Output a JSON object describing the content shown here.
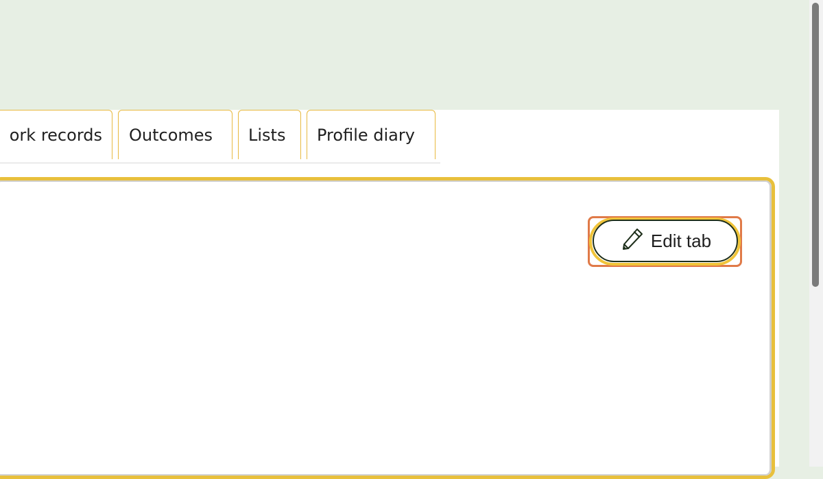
{
  "tabs": [
    {
      "label": "ork records",
      "active": false
    },
    {
      "label": "Outcomes",
      "active": false
    },
    {
      "label": "Lists",
      "active": true
    },
    {
      "label": "Profile diary",
      "active": false
    }
  ],
  "actions": {
    "edit_label": "Edit tab",
    "edit_icon": "pencil-icon"
  },
  "colors": {
    "page_background": "#e7efe4",
    "tab_accent": "#cf4b1f",
    "active_tab_accent": "#111111",
    "panel_border": "#e8c03c",
    "focus_outline": "#e07a48"
  }
}
